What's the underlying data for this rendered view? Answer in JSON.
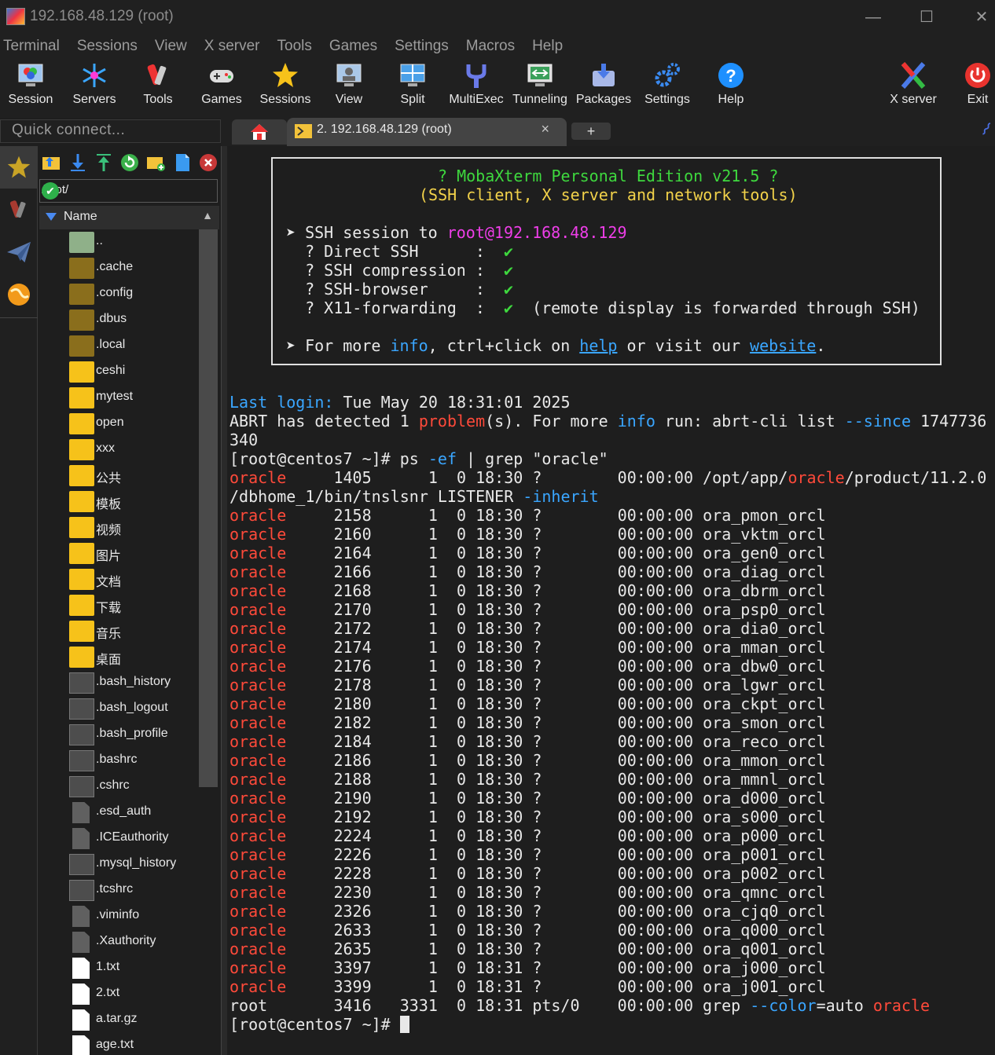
{
  "window": {
    "title": "192.168.48.129 (root)"
  },
  "menu": [
    "Terminal",
    "Sessions",
    "View",
    "X server",
    "Tools",
    "Games",
    "Settings",
    "Macros",
    "Help"
  ],
  "toolbar": {
    "session": "Session",
    "servers": "Servers",
    "tools": "Tools",
    "games": "Games",
    "sessions": "Sessions",
    "view": "View",
    "split": "Split",
    "multiexec": "MultiExec",
    "tunneling": "Tunneling",
    "packages": "Packages",
    "settings": "Settings",
    "help": "Help",
    "xserver": "X server",
    "exit": "Exit"
  },
  "quick_connect": {
    "placeholder": "Quick connect..."
  },
  "tabs": {
    "active_label": "2. 192.168.48.129 (root)",
    "close": "×",
    "new": "+"
  },
  "browser": {
    "path": "/root/",
    "column": "Name",
    "files": [
      {
        "name": "..",
        "type": "up"
      },
      {
        "name": ".cache",
        "type": "folder-dim"
      },
      {
        "name": ".config",
        "type": "folder-dim"
      },
      {
        "name": ".dbus",
        "type": "folder-dim"
      },
      {
        "name": ".local",
        "type": "folder-dim"
      },
      {
        "name": "ceshi",
        "type": "folder"
      },
      {
        "name": "mytest",
        "type": "folder"
      },
      {
        "name": "open",
        "type": "folder"
      },
      {
        "name": "xxx",
        "type": "folder"
      },
      {
        "name": "公共",
        "type": "folder"
      },
      {
        "name": "模板",
        "type": "folder"
      },
      {
        "name": "视频",
        "type": "folder"
      },
      {
        "name": "图片",
        "type": "folder"
      },
      {
        "name": "文档",
        "type": "folder"
      },
      {
        "name": "下载",
        "type": "folder"
      },
      {
        "name": "音乐",
        "type": "folder"
      },
      {
        "name": "桌面",
        "type": "folder"
      },
      {
        "name": ".bash_history",
        "type": "term"
      },
      {
        "name": ".bash_logout",
        "type": "term"
      },
      {
        "name": ".bash_profile",
        "type": "term"
      },
      {
        "name": ".bashrc",
        "type": "term"
      },
      {
        "name": ".cshrc",
        "type": "term"
      },
      {
        "name": ".esd_auth",
        "type": "doc"
      },
      {
        "name": ".ICEauthority",
        "type": "doc"
      },
      {
        "name": ".mysql_history",
        "type": "term"
      },
      {
        "name": ".tcshrc",
        "type": "term"
      },
      {
        "name": ".viminfo",
        "type": "doc"
      },
      {
        "name": ".Xauthority",
        "type": "doc"
      },
      {
        "name": "1.txt",
        "type": "txt"
      },
      {
        "name": "2.txt",
        "type": "txt"
      },
      {
        "name": "a.tar.gz",
        "type": "txt"
      },
      {
        "name": "age.txt",
        "type": "txt"
      }
    ]
  },
  "banner": {
    "title": "? MobaXterm Personal Edition v21.5 ?",
    "subtitle": "(SSH client, X server and network tools)",
    "ssh_prefix": "➤ SSH session to ",
    "ssh_target": "root@192.168.48.129",
    "direct": "  ? Direct SSH      :  ",
    "compression": "  ? SSH compression :  ",
    "browser": "  ? SSH-browser     :  ",
    "x11": "  ? X11-forwarding  :  ",
    "check": "✔",
    "x11_note": "  (remote display is forwarded through SSH)",
    "more_prefix": "➤ For more ",
    "more_info": "info",
    "more_mid": ", ctrl+click on ",
    "more_help": "help",
    "more_or": " or visit our ",
    "more_site": "website",
    "more_end": "."
  },
  "terminal": {
    "last_login_label": "Last login:",
    "last_login_value": " Tue May 20 18:31:01 2025",
    "abrt_a": "ABRT has detected 1 ",
    "abrt_problem": "problem",
    "abrt_b": "(s). For more ",
    "abrt_info": "info",
    "abrt_c": " run: abrt-cli list ",
    "abrt_since": "--since",
    "abrt_d": " 1747736",
    "abrt_wrap": "340",
    "prompt1_a": "[root@centos7 ~]# ps ",
    "prompt1_ef": "-ef",
    "prompt1_b": " | grep \"oracle\"",
    "first_user": "oracle",
    "first_a": "     1405      1  0 18:30 ?        00:00:00 /opt/app/",
    "first_oracle": "oracle",
    "first_b": "/product/11.2.0",
    "first_wrap_a": "/dbhome_1/bin/tnslsnr LISTENER ",
    "first_wrap_inherit": "-inherit",
    "procs": [
      {
        "pid": "2158",
        "time": "18:30",
        "cmd": "ora_pmon_orcl"
      },
      {
        "pid": "2160",
        "time": "18:30",
        "cmd": "ora_vktm_orcl"
      },
      {
        "pid": "2164",
        "time": "18:30",
        "cmd": "ora_gen0_orcl"
      },
      {
        "pid": "2166",
        "time": "18:30",
        "cmd": "ora_diag_orcl"
      },
      {
        "pid": "2168",
        "time": "18:30",
        "cmd": "ora_dbrm_orcl"
      },
      {
        "pid": "2170",
        "time": "18:30",
        "cmd": "ora_psp0_orcl"
      },
      {
        "pid": "2172",
        "time": "18:30",
        "cmd": "ora_dia0_orcl"
      },
      {
        "pid": "2174",
        "time": "18:30",
        "cmd": "ora_mman_orcl"
      },
      {
        "pid": "2176",
        "time": "18:30",
        "cmd": "ora_dbw0_orcl"
      },
      {
        "pid": "2178",
        "time": "18:30",
        "cmd": "ora_lgwr_orcl"
      },
      {
        "pid": "2180",
        "time": "18:30",
        "cmd": "ora_ckpt_orcl"
      },
      {
        "pid": "2182",
        "time": "18:30",
        "cmd": "ora_smon_orcl"
      },
      {
        "pid": "2184",
        "time": "18:30",
        "cmd": "ora_reco_orcl"
      },
      {
        "pid": "2186",
        "time": "18:30",
        "cmd": "ora_mmon_orcl"
      },
      {
        "pid": "2188",
        "time": "18:30",
        "cmd": "ora_mmnl_orcl"
      },
      {
        "pid": "2190",
        "time": "18:30",
        "cmd": "ora_d000_orcl"
      },
      {
        "pid": "2192",
        "time": "18:30",
        "cmd": "ora_s000_orcl"
      },
      {
        "pid": "2224",
        "time": "18:30",
        "cmd": "ora_p000_orcl"
      },
      {
        "pid": "2226",
        "time": "18:30",
        "cmd": "ora_p001_orcl"
      },
      {
        "pid": "2228",
        "time": "18:30",
        "cmd": "ora_p002_orcl"
      },
      {
        "pid": "2230",
        "time": "18:30",
        "cmd": "ora_qmnc_orcl"
      },
      {
        "pid": "2326",
        "time": "18:30",
        "cmd": "ora_cjq0_orcl"
      },
      {
        "pid": "2633",
        "time": "18:30",
        "cmd": "ora_q000_orcl"
      },
      {
        "pid": "2635",
        "time": "18:30",
        "cmd": "ora_q001_orcl"
      },
      {
        "pid": "3397",
        "time": "18:31",
        "cmd": "ora_j000_orcl"
      },
      {
        "pid": "3399",
        "time": "18:31",
        "cmd": "ora_j001_orcl"
      }
    ],
    "proc_user": "oracle",
    "proc_ppid": "1",
    "grep_line_a": "root       3416   3331  0 18:31 pts/0    00:00:00 grep ",
    "grep_color": "--color",
    "grep_line_b": "=auto ",
    "grep_oracle": "oracle",
    "prompt2": "[root@centos7 ~]# "
  },
  "colors": {
    "green": "#3ed83e",
    "pink": "#ee3ee8",
    "blue": "#3aa6ff",
    "red": "#ff4a3a",
    "folder": "#f6c21a"
  }
}
